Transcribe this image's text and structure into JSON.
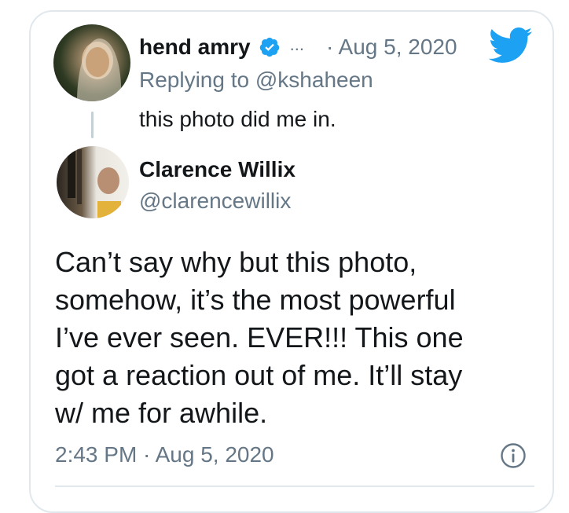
{
  "reply_tweet": {
    "author_name": "hend amry",
    "ellipsis": "...",
    "separator": "·",
    "date": "Aug 5, 2020",
    "replying_prefix": "Replying to",
    "replying_handle": "@kshaheen",
    "text": "this photo did me in."
  },
  "quoted_tweet": {
    "author_name": "Clarence Willix",
    "author_handle": "@clarencewillix",
    "text_lines": [
      "Can’t say why but this photo,",
      "somehow, it’s the most powerful",
      "I’ve ever seen.  EVER!!!  This one",
      "got a reaction out of me.  It’ll stay",
      "w/ me for awhile."
    ],
    "timestamp": "2:43 PM · Aug 5, 2020"
  },
  "icons": {
    "verified": "verified-badge-icon",
    "brand": "twitter-bird-icon",
    "info": "info-icon"
  },
  "colors": {
    "brand_blue": "#1da1f2",
    "secondary_text": "#657786",
    "primary_text": "#14171a",
    "border": "#e1e8ed"
  }
}
